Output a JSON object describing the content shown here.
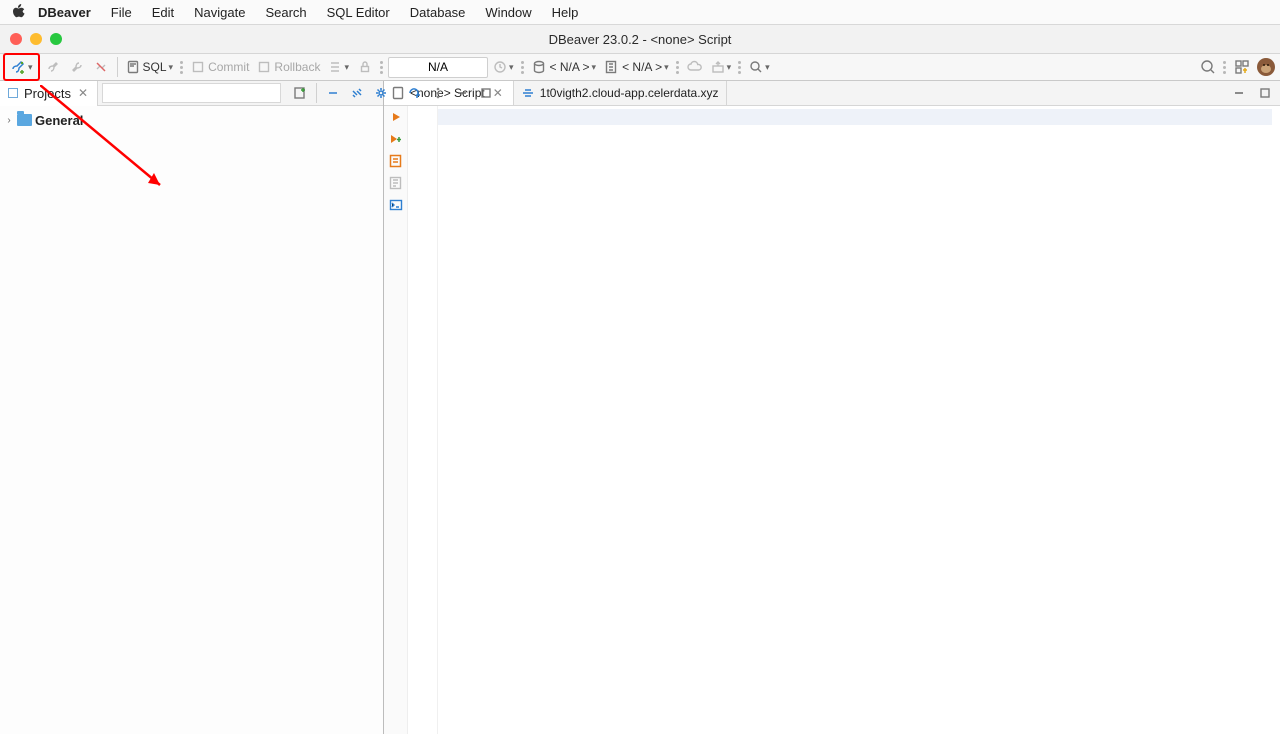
{
  "menubar": {
    "app": "DBeaver",
    "items": [
      "File",
      "Edit",
      "Navigate",
      "Search",
      "SQL Editor",
      "Database",
      "Window",
      "Help"
    ]
  },
  "window": {
    "title": "DBeaver 23.0.2 - <none> Script"
  },
  "toolbar": {
    "sql_label": "SQL",
    "commit_label": "Commit",
    "rollback_label": "Rollback",
    "datasource_value": "N/A",
    "db_selector": "< N/A >",
    "schema_selector": "< N/A >"
  },
  "sidebar": {
    "tab_label": "Projects",
    "tree": {
      "root": "General"
    }
  },
  "editor": {
    "tab1": "<none> Script",
    "tab2": "1t0vigth2.cloud-app.celerdata.xyz"
  }
}
